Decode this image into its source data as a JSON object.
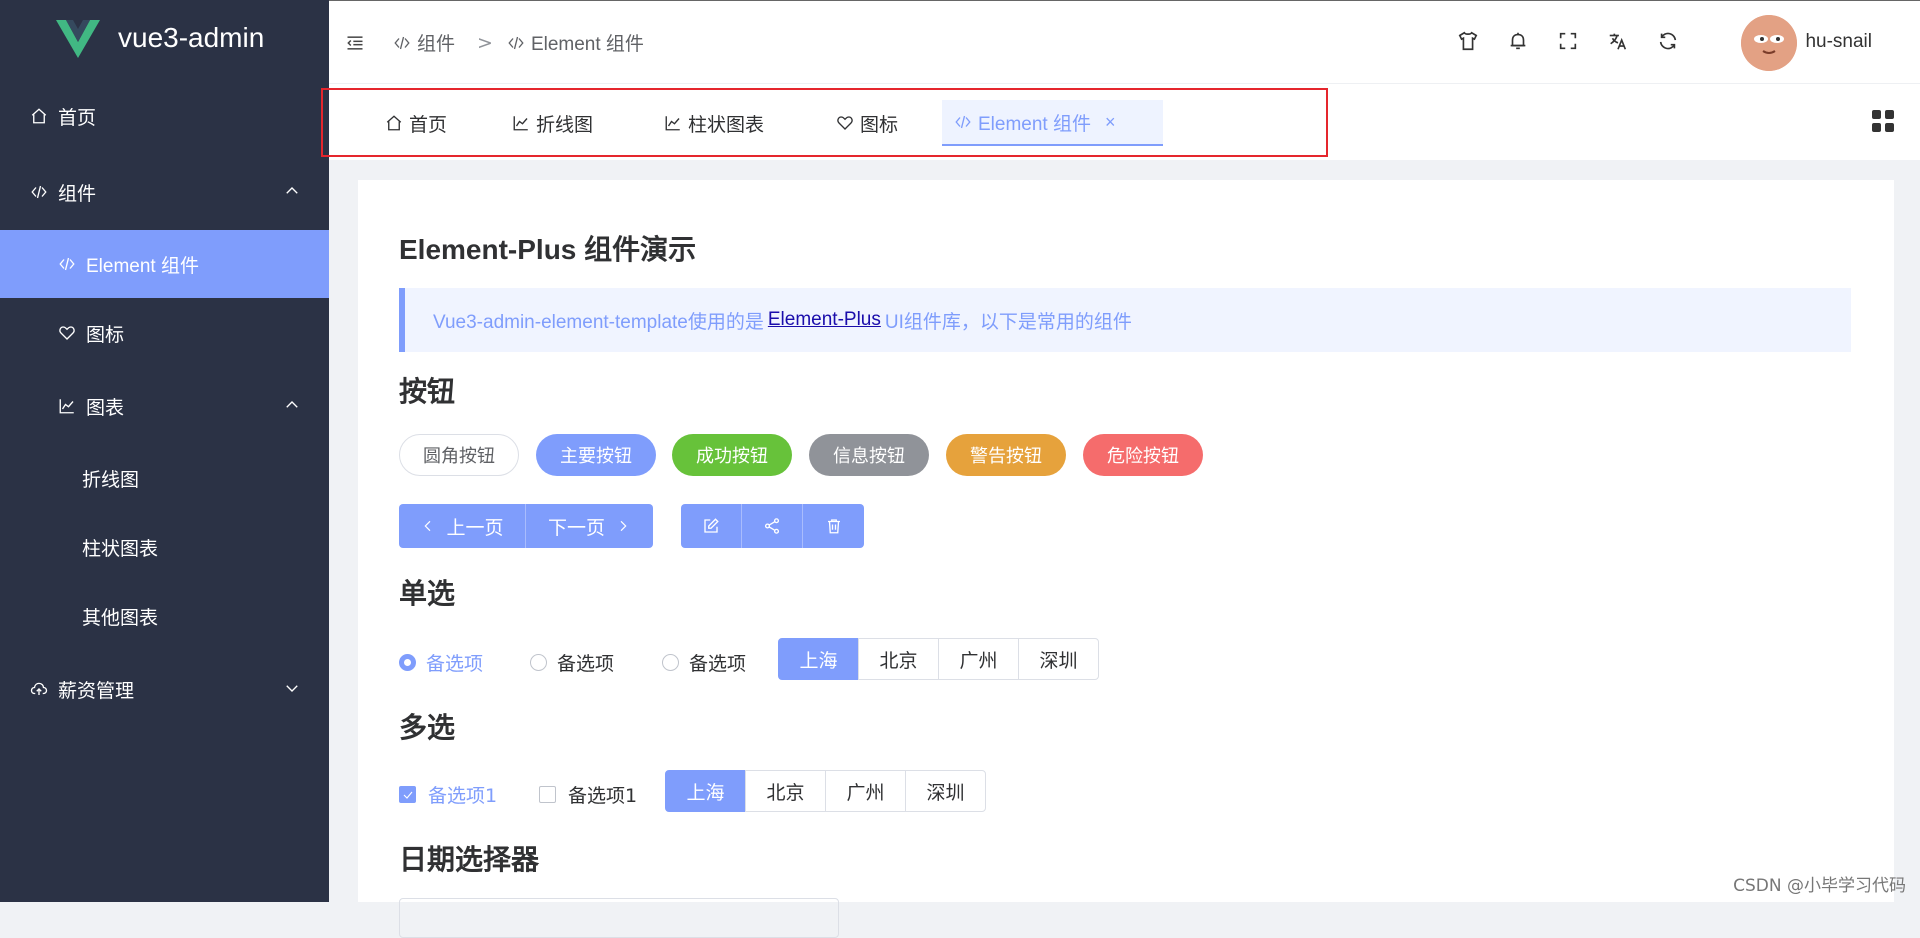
{
  "app": {
    "title": "vue3-admin"
  },
  "sidebar": {
    "items": [
      {
        "label": "首页"
      },
      {
        "label": "组件"
      },
      {
        "label": "Element 组件"
      },
      {
        "label": "图标"
      },
      {
        "label": "图表"
      },
      {
        "label": "折线图"
      },
      {
        "label": "柱状图表"
      },
      {
        "label": "其他图表"
      },
      {
        "label": "薪资管理"
      }
    ]
  },
  "header": {
    "breadcrumb": [
      "组件",
      "Element 组件"
    ],
    "breadcrumb_sep": ">",
    "username": "hu-snail"
  },
  "tags": [
    {
      "label": "首页"
    },
    {
      "label": "折线图"
    },
    {
      "label": "柱状图表"
    },
    {
      "label": "图标"
    },
    {
      "label": "Element 组件",
      "close": "×"
    }
  ],
  "main": {
    "title": "Element-Plus 组件演示",
    "alert": {
      "prefix": "Vue3-admin-element-template使用的是",
      "link": "Element-Plus",
      "suffix": "UI组件库，以下是常用的组件"
    },
    "sections": {
      "buttons": "按钮",
      "radio": "单选",
      "checkbox": "多选",
      "date": "日期选择器"
    },
    "round_buttons": [
      "圆角按钮",
      "主要按钮",
      "成功按钮",
      "信息按钮",
      "警告按钮",
      "危险按钮"
    ],
    "pager": {
      "prev": "上一页",
      "next": "下一页"
    },
    "radios": [
      "备选项",
      "备选项",
      "备选项"
    ],
    "cities": [
      "上海",
      "北京",
      "广州",
      "深圳"
    ],
    "checks": [
      "备选项1",
      "备选项1"
    ]
  },
  "colors": {
    "primary": "#7f9dfc",
    "success": "#67c23a",
    "info": "#909399",
    "warning": "#e6a23c",
    "danger": "#f56c6c",
    "sidebar_bg": "#2b3245"
  },
  "watermark": "CSDN @小毕学习代码"
}
